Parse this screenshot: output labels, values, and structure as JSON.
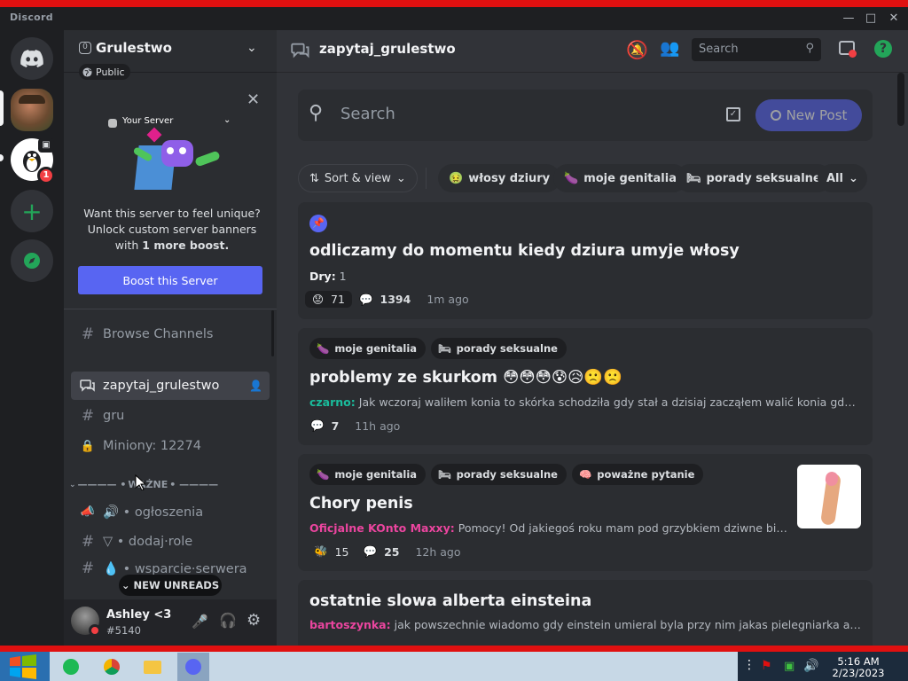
{
  "window": {
    "title": "Discord"
  },
  "server": {
    "name": "Grulestwo",
    "badge": "Public",
    "boost_count_glyph": "0"
  },
  "boost": {
    "banner_label": "Your Server",
    "line1": "Want this server to feel unique?",
    "line2": "Unlock custom server banners",
    "line3_pre": "with ",
    "line3_bold": "1 more boost.",
    "button": "Boost this Server"
  },
  "channels": {
    "browse": "Browse Channels",
    "active": "zapytaj_grulestwo",
    "gru": "gru",
    "miniony": "Miniony: 12274",
    "category": "WAŻNE",
    "category_deco": "———— • ",
    "category_deco2": " • ————",
    "ogloszenia": "🔊 • ogłoszenia",
    "dodaj": "▽ • dodaj·role",
    "wsparcie": "💧 • wsparcie·serwera",
    "new_unreads": "NEW UNREADS"
  },
  "user": {
    "name": "Ashley <3",
    "tag": "#5140"
  },
  "header": {
    "channel": "zapytaj_grulestwo",
    "search_placeholder": "Search"
  },
  "forum": {
    "search_placeholder": "Search",
    "new_post": "New Post",
    "sort_label": "Sort & view",
    "filters": [
      "włosy dziury",
      "moje genitalia",
      "porady seksualne",
      "All"
    ]
  },
  "posts": [
    {
      "title": "odliczamy do momentu kiedy dziura umyje włosy",
      "author": "Dry:",
      "preview": " 1",
      "reaction_count": "71",
      "reply_count": "1394",
      "ago": "1m ago"
    },
    {
      "tags": [
        "moje genitalia",
        "porady seksualne"
      ],
      "title": "problemy ze skurkom 😳😳😳😰😥🙁🙁",
      "author": "czarno:",
      "preview": " Jak wczoraj waliłem konia to skórka schodziła gdy stał a dzisiaj zacząłem walić konia gdy stał ...",
      "reply_count": "7",
      "ago": "11h ago"
    },
    {
      "tags": [
        "moje genitalia",
        "porady seksualne",
        "poważne pytanie"
      ],
      "title": "Chory penis",
      "author": "Oficjalne KOnto Maxxy:",
      "preview": " Pomocy! Od jakiegoś roku mam pod grzybkiem dziwne białe kul...",
      "reaction_count": "15",
      "reply_count": "25",
      "ago": "12h ago"
    },
    {
      "title": "ostatnie slowa alberta einsteina",
      "author": "bartoszynka:",
      "preview": " jak powszechnie wiadomo gdy einstein umieral byla przy nim jakas pielegniarka a ze byla..."
    }
  ],
  "taskbar": {
    "time": "5:16 AM",
    "date": "2/23/2023"
  },
  "colors": {
    "blurple": "#5865f2",
    "green": "#23a559",
    "red": "#f23f43",
    "pink": "#eb459f"
  },
  "icons": [
    "discord-logo-icon",
    "add-server-icon",
    "explore-icon",
    "chevron-down-icon",
    "globe-icon",
    "close-icon",
    "hashtag-icon",
    "forum-icon",
    "lock-icon",
    "mic-icon",
    "headphones-icon",
    "gear-icon",
    "mute-bell-icon",
    "members-icon",
    "search-icon",
    "inbox-icon",
    "help-icon",
    "windows-start-icon"
  ]
}
